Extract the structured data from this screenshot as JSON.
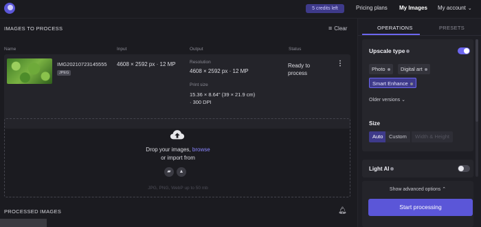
{
  "topbar": {
    "credits": "5 credits left",
    "nav": {
      "pricing": "Pricing plans",
      "my_images": "My Images",
      "my_account": "My account"
    }
  },
  "images_to_process": {
    "title": "IMAGES TO PROCESS",
    "clear_label": "Clear",
    "columns": [
      "Name",
      "Input",
      "Output",
      "Status"
    ],
    "file": {
      "name": "IMG20210723145555",
      "format": "JPEG",
      "input": "4608 × 2592 px · 12 MP",
      "output_resolution_label": "Resolution",
      "output_resolution": "4608 × 2592 px · 12 MP",
      "print_size_label": "Print size",
      "print_size_line1": "15.36 × 8.64\" (39 × 21.9 cm)",
      "print_size_line2": "· 300 DPI",
      "status": "Ready to process"
    }
  },
  "dropzone": {
    "line1_prefix": "Drop your images, ",
    "browse": "browse",
    "line2": "or import from",
    "hint": "JPG, PNG, WebP up to 50 mb"
  },
  "processed": {
    "title": "PROCESSED IMAGES"
  },
  "progress": {
    "fill_percent": 13
  },
  "panel": {
    "tabs": [
      "OPERATIONS",
      "PRESETS"
    ],
    "upscale_type": "Upscale type",
    "types": [
      "Photo",
      "Digital art",
      "Smart Enhance"
    ],
    "older_versions": "Older versions",
    "size": {
      "title": "Size",
      "options": [
        "Auto",
        "Custom",
        "Width & Height"
      ]
    },
    "light_ai": "Light AI",
    "advanced": "Show advanced options",
    "start": "Start processing"
  },
  "colors": {
    "accent": "#5b56d8",
    "accent_light": "#8a86ff",
    "bg": "#1b1b20"
  }
}
